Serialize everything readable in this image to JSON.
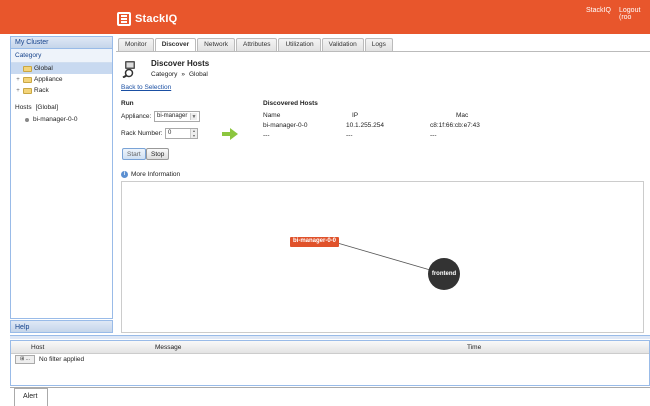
{
  "header": {
    "app_name": "StackIQ",
    "nav_stackiq": "StackIQ",
    "logout": "Logout (roo"
  },
  "sidebar": {
    "title": "My Cluster",
    "category_label": "Category",
    "tree": [
      {
        "label": "Global",
        "selected": true
      },
      {
        "label": "Appliance",
        "selected": false
      },
      {
        "label": "Rack",
        "selected": false
      }
    ],
    "hosts_label": "Hosts",
    "hosts_filter": "[Global]",
    "hosts": [
      "bi-manager-0-0"
    ],
    "help": "Help"
  },
  "tabs": [
    "Monitor",
    "Discover",
    "Network",
    "Attributes",
    "Utilization",
    "Validation",
    "Logs"
  ],
  "active_tab": "Discover",
  "discover": {
    "title": "Discover Hosts",
    "crumb_category": "Category",
    "crumb_sep": "»",
    "crumb_value": "Global",
    "back_link": "Back to Selection",
    "run_title": "Run",
    "appliance_label": "Appliance:",
    "appliance_value": "bi-manager",
    "rack_label": "Rack Number:",
    "rack_value": "0",
    "start": "Start",
    "stop": "Stop",
    "discovered_title": "Discovered Hosts",
    "columns": [
      "Name",
      "IP",
      "Mac"
    ],
    "rows": [
      [
        "bi-manager-0-0",
        "10.1.255.254",
        "c8:1f:66:cb:e7:43"
      ],
      [
        "---",
        "---",
        "---"
      ]
    ],
    "more_info": "More Information"
  },
  "graph": {
    "node_host": "bi-manager-0-0",
    "node_frontend": "frontend"
  },
  "bottom": {
    "columns": [
      "Host",
      "Message",
      "Time"
    ],
    "filter_button": "⊞ ...",
    "filter_text": "No filter applied",
    "alert_tab": "Alert"
  },
  "colors": {
    "brand": "#e8562c",
    "accent": "#99bbe8"
  }
}
